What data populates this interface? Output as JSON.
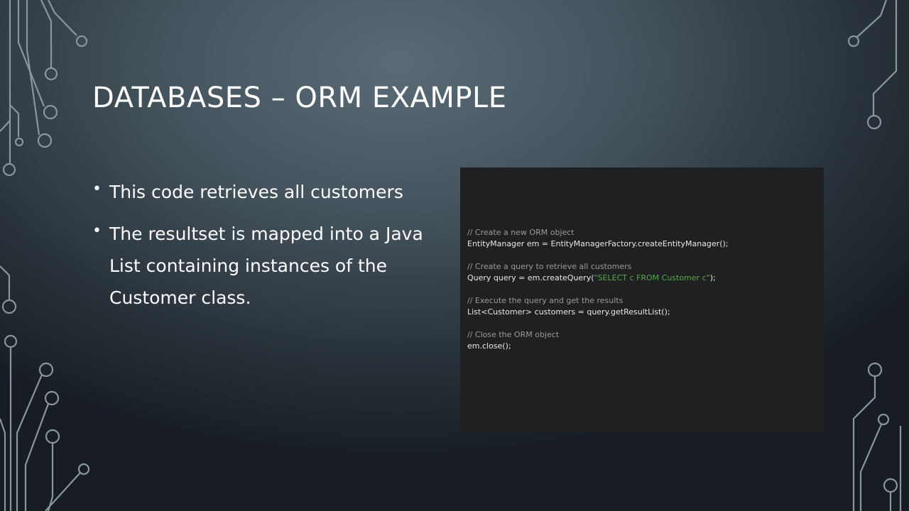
{
  "slide": {
    "title": "DATABASES – ORM EXAMPLE",
    "bullets": [
      {
        "text": "This code retrieves all customers"
      },
      {
        "text": "The resultset is mapped into a Java List containing instances of the Customer class."
      }
    ]
  },
  "code": {
    "lines": [
      {
        "kind": "comment",
        "text": "// Create a new ORM object"
      },
      {
        "kind": "code",
        "text": "EntityManager em = EntityManagerFactory.createEntityManager();"
      },
      {
        "kind": "blank",
        "text": ""
      },
      {
        "kind": "comment",
        "text": "// Create a query to retrieve all customers"
      },
      {
        "kind": "code-string",
        "pre": "Query query = em.createQuery(",
        "str": "\"SELECT c FROM Customer c\"",
        "post": ");"
      },
      {
        "kind": "blank",
        "text": ""
      },
      {
        "kind": "comment",
        "text": "// Execute the query and get the results"
      },
      {
        "kind": "code",
        "text": "List<Customer> customers = query.getResultList();"
      },
      {
        "kind": "blank",
        "text": ""
      },
      {
        "kind": "comment",
        "text": "// Close the ORM object"
      },
      {
        "kind": "code",
        "text": "em.close();"
      }
    ]
  },
  "colors": {
    "code_background": "#1f2022",
    "comment": "#9a9a9a",
    "string_literal": "#57a64a",
    "circuit_lines": "#8a9aa4"
  }
}
